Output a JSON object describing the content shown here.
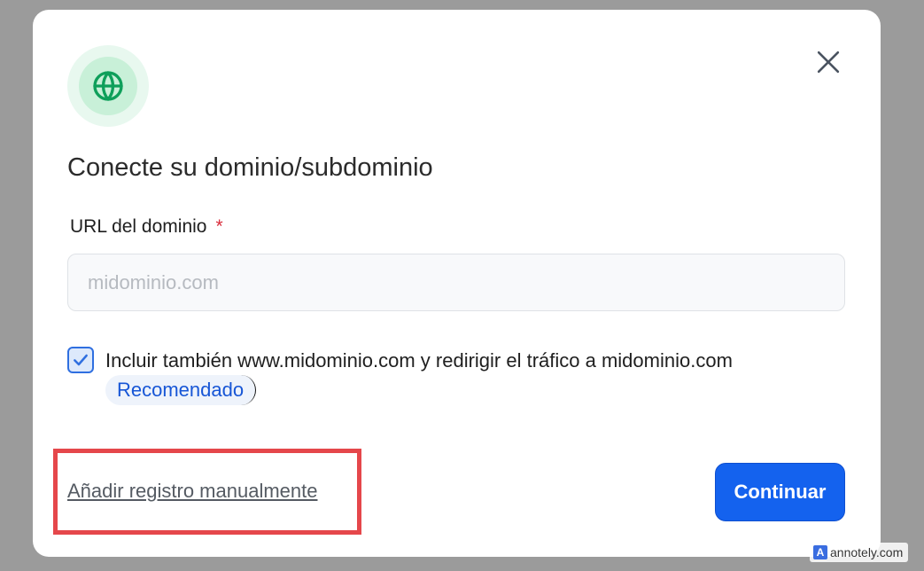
{
  "dialog": {
    "title": "Conecte su dominio/subdominio",
    "icon": "globe-icon",
    "close_icon": "close-icon",
    "accent_color": "#1462ee",
    "icon_color": "#0e9f5a"
  },
  "form": {
    "url_label": "URL del dominio",
    "required_mark": "*",
    "url_value": "",
    "url_placeholder": "midominio.com",
    "include_www_checked": true,
    "include_www_text": "Incluir también www.midominio.com y redirigir el tráfico a midominio.com",
    "recommended_badge": "Recomendado"
  },
  "footer": {
    "manual_link": "Añadir registro manualmente",
    "continue_label": "Continuar"
  },
  "watermark": {
    "text": "annotely.com",
    "logo": "A"
  }
}
